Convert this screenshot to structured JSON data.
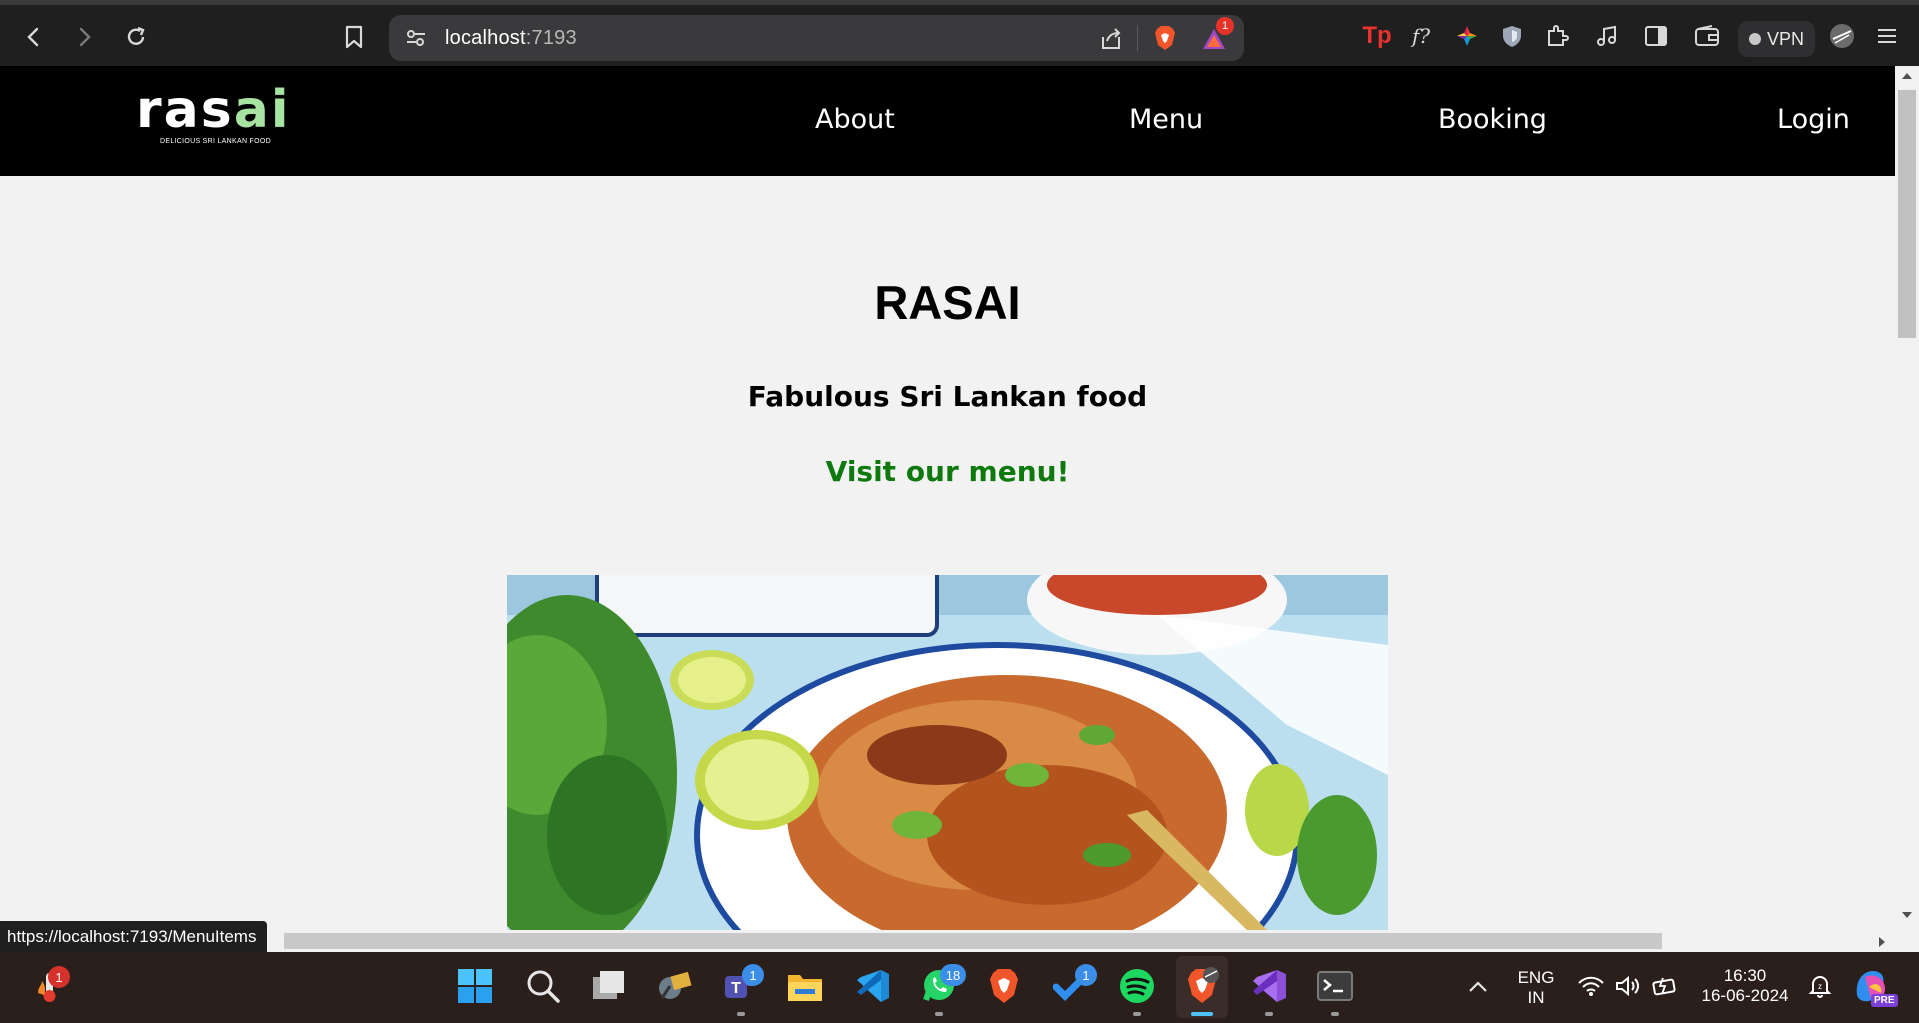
{
  "browser": {
    "url_host": "localhost",
    "url_port": ":7193",
    "shields_badge": "1",
    "vpn_label": "VPN",
    "status_url": "https://localhost:7193/MenuItems"
  },
  "site": {
    "logo_word_main": "ras",
    "logo_word_accent": "ai",
    "logo_tagline": "DELICIOUS SRI LANKAN FOOD",
    "nav": [
      {
        "label": "About"
      },
      {
        "label": "Menu"
      },
      {
        "label": "Booking"
      },
      {
        "label": "Login"
      }
    ],
    "hero": {
      "title": "RASAI",
      "subtitle": "Fabulous Sri Lankan food",
      "cta": "Visit our menu!"
    }
  },
  "taskbar": {
    "weather_badge": "1",
    "teams_badge": "1",
    "whatsapp_badge": "18",
    "todo_badge": "1",
    "lang_line1": "ENG",
    "lang_line2": "IN",
    "time": "16:30",
    "date": "16-06-2024",
    "copilot_label": "PRE"
  },
  "colors": {
    "nav_bg": "#000000",
    "page_bg": "#f2f2f2",
    "cta": "#0e7a0e",
    "logo_accent": "#a7e3a1"
  }
}
